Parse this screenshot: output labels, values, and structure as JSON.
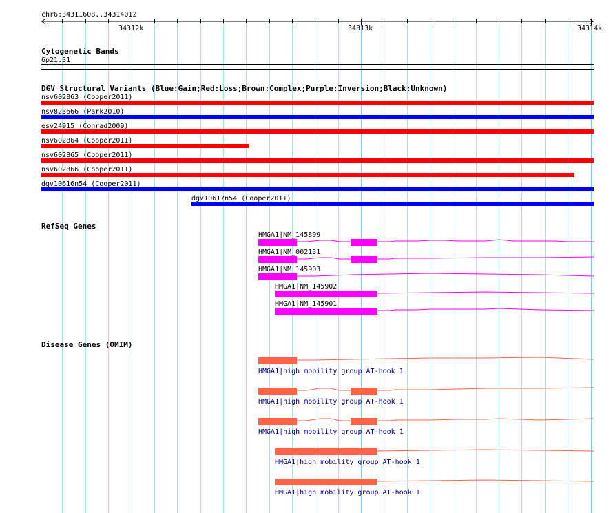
{
  "ruler": {
    "region": "chr6:34311608..34314012",
    "ticks": [
      "34312k",
      "34313k",
      "34314k"
    ]
  },
  "tracks": {
    "cytoband": {
      "title": "Cytogenetic Bands",
      "band": "6p21.31"
    },
    "dgv": {
      "title": "DGV Structural Variants (Blue:Gain;Red:Loss;Brown:Complex;Purple:Inversion;Black:Unknown)",
      "colors": {
        "gain": "#0000ff",
        "loss": "#ff0000"
      },
      "items": [
        {
          "label": "nsv602863 (Cooper2011)",
          "type": "loss"
        },
        {
          "label": "nsv823666 (Park2010)",
          "type": "gain"
        },
        {
          "label": "esv24915 (Conrad2009)",
          "type": "loss"
        },
        {
          "label": "nsv602864 (Cooper2011)",
          "type": "loss"
        },
        {
          "label": "nsv602865 (Cooper2011)",
          "type": "loss"
        },
        {
          "label": "nsv602866 (Cooper2011)",
          "type": "loss"
        },
        {
          "label": "dgv10616n54 (Cooper2011)",
          "type": "gain"
        },
        {
          "label": "dgv10617n54 (Cooper2011)",
          "type": "gain"
        }
      ]
    },
    "refseq": {
      "title": "RefSeq Genes",
      "color": "#ff00ff",
      "items": [
        {
          "label": "HMGA1|NM_145899"
        },
        {
          "label": "HMGA1|NM_002131"
        },
        {
          "label": "HMGA1|NM_145903"
        },
        {
          "label": "HMGA1|NM_145902"
        },
        {
          "label": "HMGA1|NM_145901"
        }
      ]
    },
    "omim": {
      "title": "Disease Genes (OMIM)",
      "color": "#ff6347",
      "items": [
        {
          "label": "HMGA1|high mobility group AT-hook 1"
        },
        {
          "label": "HMGA1|high mobility group AT-hook 1"
        },
        {
          "label": "HMGA1|high mobility group AT-hook 1"
        },
        {
          "label": "HMGA1|high mobility group AT-hook 1"
        },
        {
          "label": "HMGA1|high mobility group AT-hook 1"
        }
      ]
    }
  }
}
